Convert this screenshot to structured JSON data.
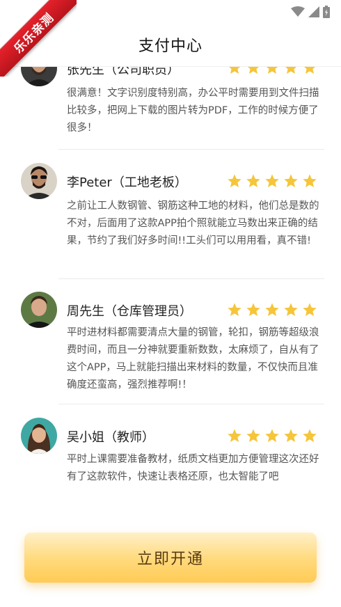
{
  "header": {
    "title": "支付中心"
  },
  "corner_badge": {
    "label": "乐乐亲测"
  },
  "reviews": [
    {
      "name": "张先生（公司职员）",
      "rating": 5,
      "text": "很满意！文字识别度特别高，办公平时需要用到文件扫描比较多，把网上下载的图片转为PDF，工作的时候方便了很多！"
    },
    {
      "name": "李Peter（工地老板）",
      "rating": 5,
      "text": "之前让工人数钢管、钢筋这种工地的材料，他们总是数的不对，后面用了这款APP拍个照就能立马数出来正确的结果，节约了我们好多时间!!工头们可以用用看，真不错!"
    },
    {
      "name": "周先生（仓库管理员）",
      "rating": 5,
      "text": "平时进材料都需要清点大量的钢管，轮扣，钢筋等超级浪费时间，而且一分神就要重新数数，太麻烦了，自从有了这个APP，马上就能扫描出来材料的数量，不仅快而且准确度还蛮高，强烈推荐啊!！"
    },
    {
      "name": "吴小姐（教师）",
      "rating": 5,
      "text": "平时上课需要准备教材，纸质文档更加方便管理这次还好有了这款软件，快速让表格还原，也太智能了吧"
    }
  ],
  "footer": {
    "activate_label": "立即开通"
  },
  "colors": {
    "star": "#f5c53a",
    "button_gradient_top": "#fff0c8",
    "button_gradient_bottom": "#ffcb55",
    "ribbon": "#d71920"
  },
  "icons": {
    "status": [
      "wifi-icon",
      "signal-icon",
      "battery-icon"
    ],
    "back": "back-arrow-icon",
    "rating": "star-icon"
  }
}
